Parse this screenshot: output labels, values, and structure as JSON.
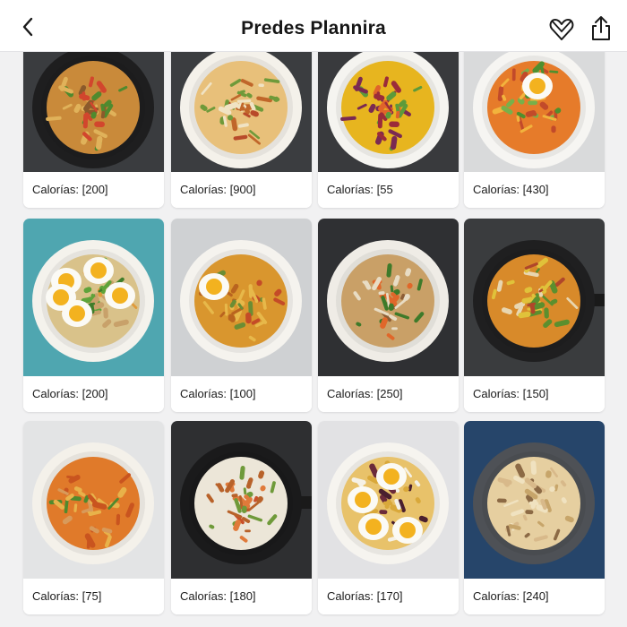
{
  "header": {
    "title": "Predes Plannira",
    "back_icon": "chevron-left-icon",
    "favorite_icon": "heart-outline-icon",
    "share_icon": "share-icon"
  },
  "colors": {
    "header_bg": "#ffffff",
    "page_bg": "#f1f1f2",
    "text": "#161616"
  },
  "cards": [
    {
      "label": "Calorías: [200]",
      "bg": "#3a3c3f",
      "plate": "#1e1e1f",
      "food": "noodles"
    },
    {
      "label": "Calorías: [900]",
      "bg": "#3b3d40",
      "plate": "#f4f1ea",
      "food": "fried-rice"
    },
    {
      "label": "Calorías: [55",
      "bg": "#393a3d",
      "plate": "#f5f4f0",
      "food": "peppers"
    },
    {
      "label": "Calorías: [430]",
      "bg": "#d9dadb",
      "plate": "#f6f5f2",
      "food": "salad-egg"
    },
    {
      "label": "Calorías: [200]",
      "bg": "#4fa6b0",
      "plate": "#f4f2ec",
      "food": "eggs-greens"
    },
    {
      "label": "Calorías: [100]",
      "bg": "#cfd1d3",
      "plate": "#f5f3ee",
      "food": "fritters-egg"
    },
    {
      "label": "Calorías: [250]",
      "bg": "#2f3033",
      "plate": "#efece6",
      "food": "noodles-mushroom"
    },
    {
      "label": "Calorías: [150]",
      "bg": "#3a3c3e",
      "plate": "#1f1f20",
      "food": "stirfry-pan"
    },
    {
      "label": "Calorías: [75]",
      "bg": "#e3e4e5",
      "plate": "#f4f1ea",
      "food": "pasta-chicken"
    },
    {
      "label": "Calorías: [180]",
      "bg": "#2e2f31",
      "plate": "#1a1a1b",
      "food": "rice-chicken-pan"
    },
    {
      "label": "Calorías: [170]",
      "bg": "#e2e2e4",
      "plate": "#f6f4ef",
      "food": "eggs-beans"
    },
    {
      "label": "Calorías: [240]",
      "bg": "#26456a",
      "plate": "#4e5156",
      "food": "pasta-bowl"
    }
  ]
}
